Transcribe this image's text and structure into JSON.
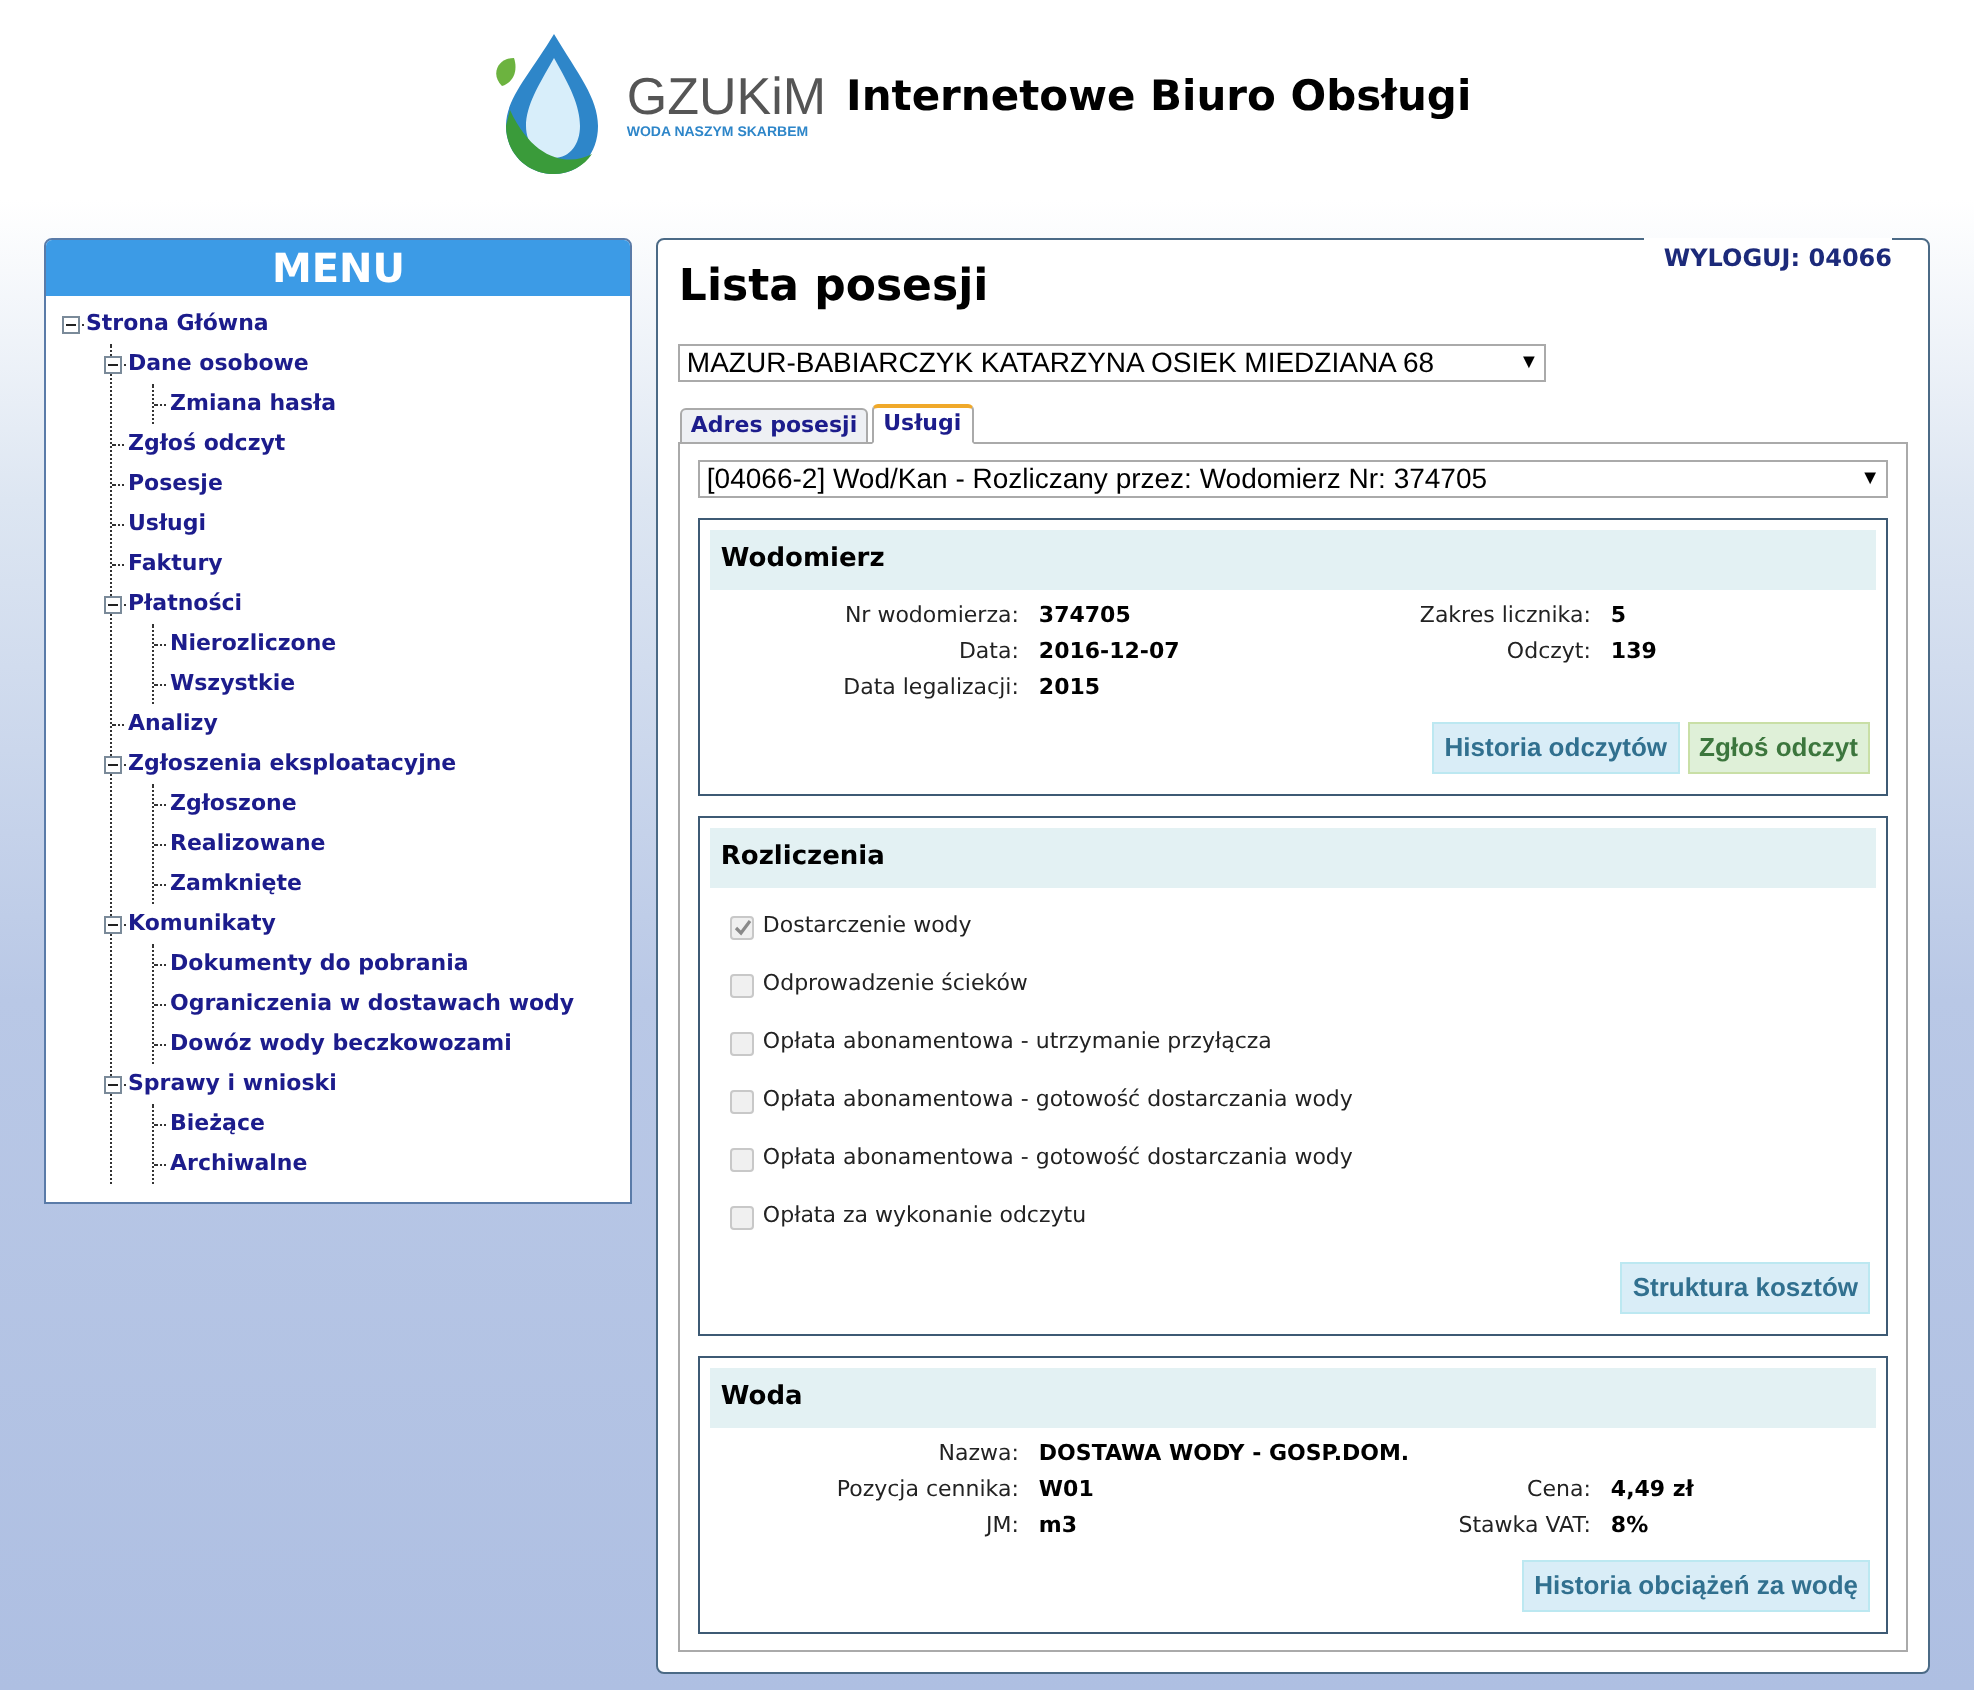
{
  "header": {
    "logo_name": "GZUKiM",
    "logo_tagline": "WODA NASZYM SKARBEM",
    "title": "Internetowe Biuro Obsługi"
  },
  "menu": {
    "title": "MENU",
    "items": [
      {
        "label": "Strona Główna",
        "expanded": true,
        "children": [
          {
            "label": "Dane osobowe",
            "expanded": true,
            "children": [
              {
                "label": "Zmiana hasła"
              }
            ]
          },
          {
            "label": "Zgłoś odczyt"
          },
          {
            "label": "Posesje"
          },
          {
            "label": "Usługi"
          },
          {
            "label": "Faktury"
          },
          {
            "label": "Płatności",
            "expanded": true,
            "children": [
              {
                "label": "Nierozliczone"
              },
              {
                "label": "Wszystkie"
              }
            ]
          },
          {
            "label": "Analizy"
          },
          {
            "label": "Zgłoszenia eksploatacyjne",
            "expanded": true,
            "children": [
              {
                "label": "Zgłoszone"
              },
              {
                "label": "Realizowane"
              },
              {
                "label": "Zamknięte"
              }
            ]
          },
          {
            "label": "Komunikaty",
            "expanded": true,
            "children": [
              {
                "label": "Dokumenty do pobrania"
              },
              {
                "label": "Ograniczenia w dostawach wody"
              },
              {
                "label": "Dowóz wody beczkowozami"
              }
            ]
          },
          {
            "label": "Sprawy i wnioski",
            "expanded": true,
            "children": [
              {
                "label": "Bieżące"
              },
              {
                "label": "Archiwalne"
              }
            ]
          }
        ]
      }
    ]
  },
  "logout": "WYLOGUJ: 04066",
  "page_title": "Lista posesji",
  "property_select": {
    "value": "MAZUR-BABIARCZYK KATARZYNA OSIEK MIEDZIANA 68",
    "caret": "▼"
  },
  "tabs": [
    {
      "label": "Adres posesji",
      "selected": false
    },
    {
      "label": "Usługi",
      "selected": true
    }
  ],
  "service_select": {
    "value": "[04066-2] Wod/Kan - Rozliczany przez: Wodomierz Nr: 374705",
    "caret": "▼"
  },
  "meter": {
    "title": "Wodomierz",
    "rows": [
      {
        "label": "Nr wodomierza:",
        "value": "374705",
        "label_2": "Zakres licznika:",
        "value_2": "5"
      },
      {
        "label": "Data:",
        "value": "2016-12-07",
        "label_2": "Odczyt:",
        "value_2": "139"
      },
      {
        "label": "Data legalizacji:",
        "value": "2015"
      }
    ],
    "buttons": [
      {
        "label": "Historia odczytów",
        "kind": "info"
      },
      {
        "label": "Zgłoś odczyt",
        "kind": "success"
      }
    ]
  },
  "settlements": {
    "title": "Rozliczenia",
    "items": [
      {
        "label": "Dostarczenie wody",
        "checked": true
      },
      {
        "label": "Odprowadzenie ścieków",
        "checked": false
      },
      {
        "label": "Opłata abonamentowa - utrzymanie przyłącza",
        "checked": false
      },
      {
        "label": "Opłata abonamentowa - gotowość dostarczania wody",
        "checked": false
      },
      {
        "label": "Opłata abonamentowa - gotowość dostarczania wody",
        "checked": false
      },
      {
        "label": "Opłata za wykonanie odczytu",
        "checked": false
      }
    ],
    "buttons": [
      {
        "label": "Struktura kosztów",
        "kind": "info"
      }
    ]
  },
  "water": {
    "title": "Woda",
    "rows": [
      {
        "label": "Nazwa:",
        "value": "DOSTAWA WODY - GOSP.DOM."
      },
      {
        "label": "Pozycja cennika:",
        "value": "W01",
        "label_2": "Cena:",
        "value_2": "4,49 zł"
      },
      {
        "label": "JM:",
        "value": "m3",
        "label_2": "Stawka VAT:",
        "value_2": "8%"
      }
    ],
    "buttons": [
      {
        "label": "Historia obciążeń za wodę",
        "kind": "info"
      }
    ]
  }
}
